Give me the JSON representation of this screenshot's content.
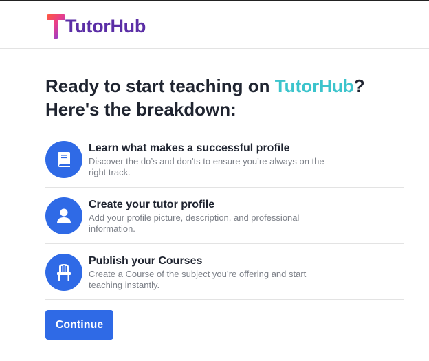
{
  "header": {
    "logo_text": "TutorHub"
  },
  "headline": {
    "prefix": "Ready to start teaching on ",
    "brand": "TutorHub",
    "suffix": "?",
    "line2": "Here's the breakdown:"
  },
  "steps": [
    {
      "icon": "book-icon",
      "title": "Learn what makes a successful profile",
      "description": "Discover the do’s and don'ts to ensure you’re always on the right track."
    },
    {
      "icon": "user-icon",
      "title": "Create your tutor profile",
      "description": "Add your profile picture, description, and professional information."
    },
    {
      "icon": "chair-icon",
      "title": "Publish your Courses",
      "description": "Create a Course of the subject you’re offering and start teaching instantly."
    }
  ],
  "actions": {
    "continue_label": "Continue"
  },
  "colors": {
    "accent": "#2f6ae6",
    "brand": "#3cc4cc",
    "logo_text": "#5b2ea6"
  }
}
